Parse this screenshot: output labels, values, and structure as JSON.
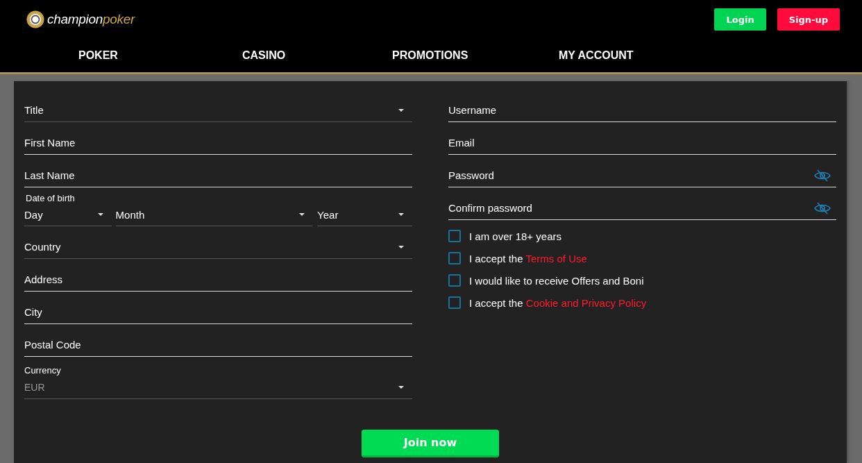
{
  "header": {
    "logo": {
      "word_1": "champion",
      "word_2": "poker"
    },
    "buttons": [
      {
        "kind": "login",
        "label": "Login"
      },
      {
        "kind": "signup",
        "label": "Sign-up"
      }
    ],
    "nav": [
      {
        "label": "POKER"
      },
      {
        "label": "CASINO"
      },
      {
        "label": "PROMOTIONS"
      },
      {
        "label": "MY ACCOUNT"
      }
    ]
  },
  "form": {
    "left_fields": [
      {
        "kind": "select",
        "placeholder": "Title"
      },
      {
        "kind": "text",
        "placeholder": "First Name"
      },
      {
        "kind": "text",
        "placeholder": "Last Name"
      },
      {
        "kind": "date",
        "label": "Date of birth",
        "parts": [
          {
            "placeholder": "Day"
          },
          {
            "placeholder": "Month"
          },
          {
            "placeholder": "Year"
          }
        ]
      },
      {
        "kind": "select",
        "placeholder": "Country"
      },
      {
        "kind": "text",
        "placeholder": "Address"
      },
      {
        "kind": "text",
        "placeholder": "City"
      },
      {
        "kind": "text",
        "placeholder": "Postal Code"
      },
      {
        "kind": "labeled_select",
        "label": "Currency",
        "value": "EUR"
      }
    ],
    "right_fields": [
      {
        "kind": "text",
        "placeholder": "Username"
      },
      {
        "kind": "text",
        "placeholder": "Email"
      },
      {
        "kind": "password",
        "placeholder": "Password"
      },
      {
        "kind": "password",
        "placeholder": "Confirm password"
      }
    ],
    "checkboxes": [
      {
        "text": "I am over 18+ years",
        "checked": false
      },
      {
        "text": "I accept the ",
        "link": "Terms of Use",
        "checked": false
      },
      {
        "text": "I would like to receive Offers and Boni",
        "checked": false
      },
      {
        "text": "I accept the ",
        "link": "Cookie and Privacy Policy",
        "checked": false
      }
    ],
    "submit": "Join now"
  }
}
